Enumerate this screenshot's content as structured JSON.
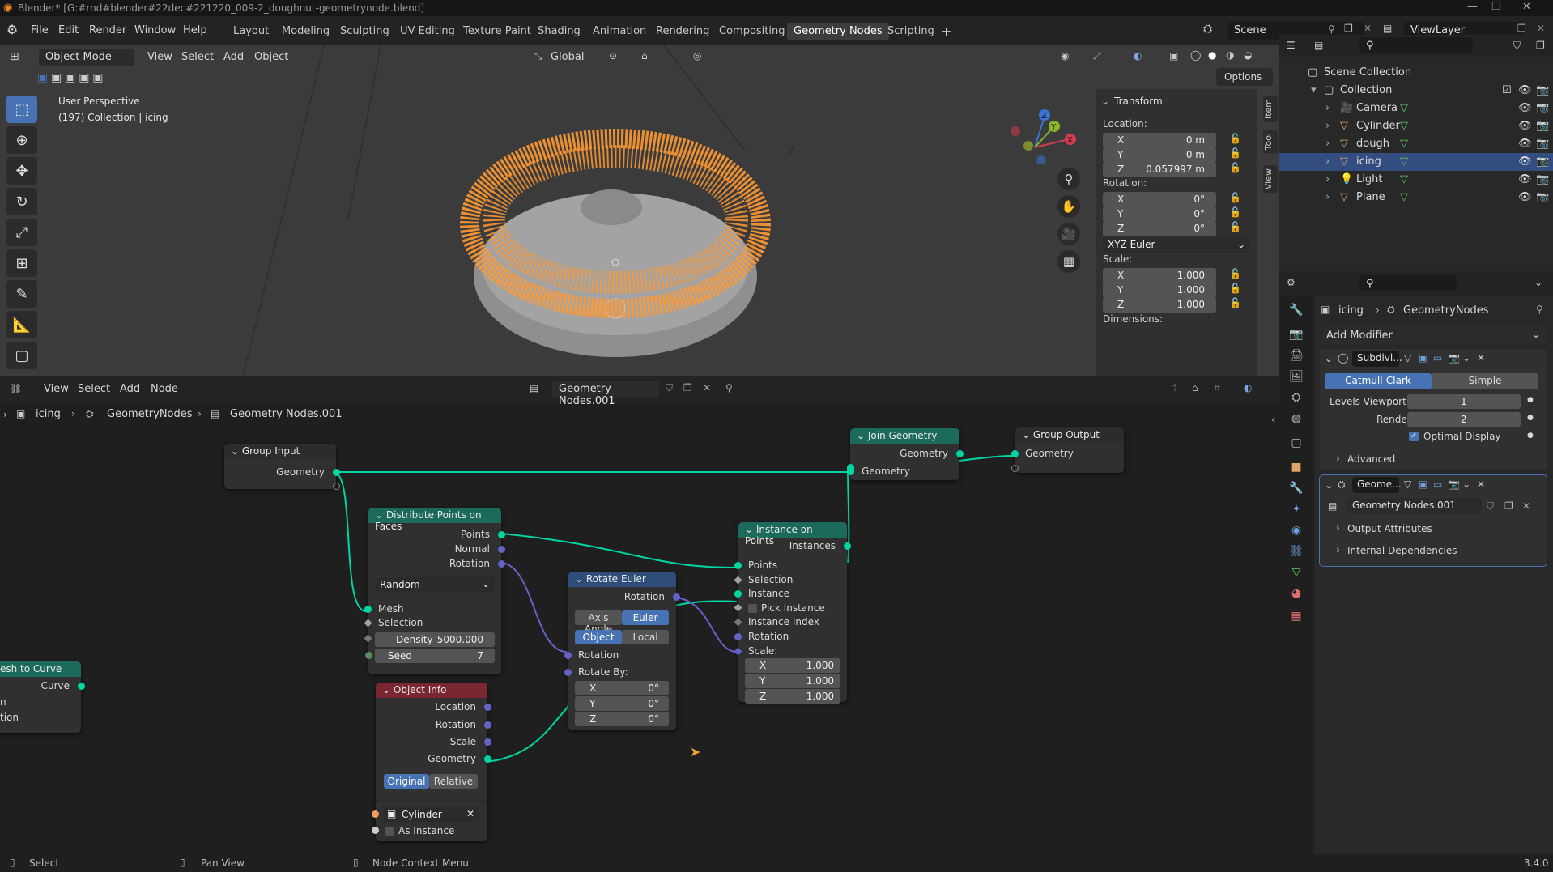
{
  "window": {
    "title": "Blender* [G:#rnd#blender#22dec#221220_009-2_doughnut-geometrynode.blend]"
  },
  "menu": [
    "File",
    "Edit",
    "Render",
    "Window",
    "Help"
  ],
  "workspaces": [
    "Layout",
    "Modeling",
    "Sculpting",
    "UV Editing",
    "Texture Paint",
    "Shading",
    "Animation",
    "Rendering",
    "Compositing",
    "Geometry Nodes",
    "Scripting"
  ],
  "active_workspace": "Geometry Nodes",
  "scene": "Scene",
  "view_layer": "ViewLayer",
  "viewport": {
    "mode": "Object Mode",
    "menus": [
      "View",
      "Select",
      "Add",
      "Object"
    ],
    "orientation": "Global",
    "options": "Options",
    "overlay_title": "User Perspective",
    "overlay_sub": "(197) Collection | icing",
    "gizmo": {
      "x": "X",
      "y": "Y",
      "z": "Z"
    }
  },
  "npanel": {
    "tabs": [
      "Item",
      "Tool",
      "View"
    ],
    "section": "Transform",
    "location_label": "Location:",
    "location": [
      {
        "axis": "X",
        "value": "0 m"
      },
      {
        "axis": "Y",
        "value": "0 m"
      },
      {
        "axis": "Z",
        "value": "0.057997 m"
      }
    ],
    "rotation_label": "Rotation:",
    "rotation": [
      {
        "axis": "X",
        "value": "0°"
      },
      {
        "axis": "Y",
        "value": "0°"
      },
      {
        "axis": "Z",
        "value": "0°"
      }
    ],
    "rotation_mode": "XYZ Euler",
    "scale_label": "Scale:",
    "scale": [
      {
        "axis": "X",
        "value": "1.000"
      },
      {
        "axis": "Y",
        "value": "1.000"
      },
      {
        "axis": "Z",
        "value": "1.000"
      }
    ],
    "dimensions_label": "Dimensions:"
  },
  "node_editor": {
    "menus": [
      "View",
      "Select",
      "Add",
      "Node"
    ],
    "tree_name": "Geometry Nodes.001",
    "breadcrumb": [
      "icing",
      "GeometryNodes",
      "Geometry Nodes.001"
    ],
    "nodes": {
      "group_input": {
        "title": "Group Input",
        "out": "Geometry"
      },
      "join_geometry": {
        "title": "Join Geometry",
        "out": "Geometry",
        "in": "Geometry"
      },
      "group_output": {
        "title": "Group Output",
        "in": "Geometry"
      },
      "distribute": {
        "title": "Distribute Points on Faces",
        "outs": [
          "Points",
          "Normal",
          "Rotation"
        ],
        "mode": "Random",
        "ins": [
          "Mesh",
          "Selection"
        ],
        "density_label": "Density",
        "density": "5000.000",
        "seed_label": "Seed",
        "seed": "7"
      },
      "rotate_euler": {
        "title": "Rotate Euler",
        "out": "Rotation",
        "type_a": "Axis Angle",
        "type_b": "Euler",
        "space_a": "Object",
        "space_b": "Local",
        "in_rotation": "Rotation",
        "rotate_by": "Rotate By:",
        "xyz": [
          {
            "axis": "X",
            "value": "0°"
          },
          {
            "axis": "Y",
            "value": "0°"
          },
          {
            "axis": "Z",
            "value": "0°"
          }
        ]
      },
      "instance_on_points": {
        "title": "Instance on Points",
        "out": "Instances",
        "ins": [
          "Points",
          "Selection",
          "Instance",
          "Pick Instance",
          "Instance Index",
          "Rotation"
        ],
        "scale_label": "Scale:",
        "scale": [
          {
            "axis": "X",
            "value": "1.000"
          },
          {
            "axis": "Y",
            "value": "1.000"
          },
          {
            "axis": "Z",
            "value": "1.000"
          }
        ]
      },
      "object_info": {
        "title": "Object Info",
        "outs": [
          "Location",
          "Rotation",
          "Scale",
          "Geometry"
        ],
        "mode_a": "Original",
        "mode_b": "Relative",
        "object": "Cylinder",
        "as_instance": "As Instance"
      },
      "mesh_to_curve": {
        "title": "esh to Curve",
        "out": "Curve",
        "frag1": "n",
        "frag2": "tion"
      }
    }
  },
  "outliner": {
    "root": "Scene Collection",
    "collection": "Collection",
    "items": [
      {
        "name": "Camera",
        "selected": false,
        "color": "#e0a46a"
      },
      {
        "name": "Cylinder",
        "selected": false,
        "color": "#e0a46a"
      },
      {
        "name": "dough",
        "selected": false,
        "color": "#e0a46a"
      },
      {
        "name": "icing",
        "selected": true,
        "color": "#e0a46a"
      },
      {
        "name": "Light",
        "selected": false,
        "color": "#e0a46a"
      },
      {
        "name": "Plane",
        "selected": false,
        "color": "#e0a46a"
      }
    ]
  },
  "properties": {
    "object": "icing",
    "modifier_path": "GeometryNodes",
    "add_modifier": "Add Modifier",
    "subdiv": {
      "name": "Subdivi...",
      "type_a": "Catmull-Clark",
      "type_b": "Simple",
      "levels_label": "Levels Viewport",
      "levels": "1",
      "render_label": "Render",
      "render": "2",
      "optimal": "Optimal Display",
      "advanced": "Advanced"
    },
    "geonodes": {
      "name": "Geome...",
      "tree": "Geometry Nodes.001",
      "output_attrs": "Output Attributes",
      "internal_deps": "Internal Dependencies"
    }
  },
  "status": {
    "left": "Select",
    "mid": "Pan View",
    "right": "Node Context Menu",
    "version": "3.4.0"
  },
  "colors": {
    "accent": "#4772b3",
    "geometry_socket": "#00d6a3",
    "selection_orange": "#ff9933",
    "geometry_header": "#1c6b5a"
  }
}
